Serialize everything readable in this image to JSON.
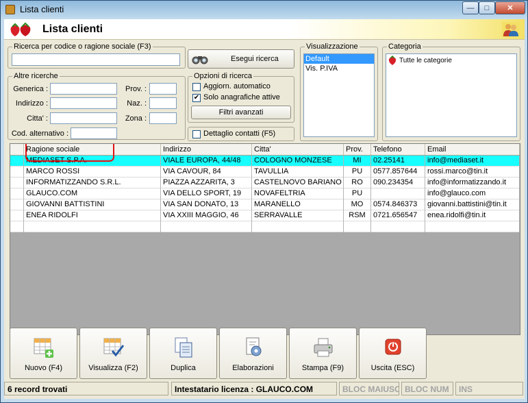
{
  "window": {
    "title": "Lista clienti",
    "minimize": "—",
    "maximize": "□",
    "close": "✕"
  },
  "header": {
    "title": "Lista clienti",
    "logo_icon": "strawberry-icon",
    "users_icon": "users-icon"
  },
  "search": {
    "group_label": "Ricerca per codice o ragione sociale (F3)",
    "value": "",
    "button_label": "Esegui ricerca",
    "button_icon": "binoculars-icon"
  },
  "other_searches": {
    "group_label": "Altre ricerche",
    "generica_label": "Generica :",
    "indirizzo_label": "Indirizzo :",
    "citta_label": "Citta' :",
    "cod_alt_label": "Cod. alternativo :",
    "prov_label": "Prov. :",
    "naz_label": "Naz. :",
    "zona_label": "Zona :"
  },
  "options": {
    "group_label": "Opzioni di ricerca",
    "aggiorn_label": "Aggiorn. automatico",
    "aggiorn_checked": false,
    "solo_label": "Solo anagrafiche attive",
    "solo_checked": true,
    "filter_button": "Filtri avanzati",
    "detail_label": "Dettaglio contatti (F5)",
    "detail_checked": false
  },
  "view": {
    "group_label": "Visualizzazione",
    "items": [
      "Default",
      "Vis. P.IVA"
    ],
    "selected": "Default"
  },
  "category": {
    "group_label": "Categoria",
    "items": [
      "Tutte le categorie"
    ]
  },
  "grid": {
    "columns": [
      "Ragione sociale",
      "Indirizzo",
      "Citta'",
      "Prov.",
      "Telefono",
      "Email"
    ],
    "rows": [
      [
        "MEDIASET S.P.A.",
        "VIALE EUROPA, 44/48",
        "COLOGNO MONZESE",
        "MI",
        "02.25141",
        "info@mediaset.it"
      ],
      [
        "MARCO ROSSI",
        "VIA CAVOUR, 84",
        "TAVULLIA",
        "PU",
        "0577.857644",
        "rossi.marco@tin.it"
      ],
      [
        "INFORMATIZZANDO S.R.L.",
        "PIAZZA AZZARITA, 3",
        "CASTELNOVO BARIANO",
        "RO",
        "090.234354",
        "info@informatizzando.it"
      ],
      [
        "GLAUCO.COM",
        "VIA DELLO SPORT, 19",
        "NOVAFELTRIA",
        "PU",
        "",
        "info@glauco.com"
      ],
      [
        "GIOVANNI BATTISTINI",
        "VIA SAN DONATO, 13",
        "MARANELLO",
        "MO",
        "0574.846373",
        "giovanni.battistini@tin.it"
      ],
      [
        "ENEA RIDOLFI",
        "VIA XXIII MAGGIO, 46",
        "SERRAVALLE",
        "RSM",
        "0721.656547",
        "enea.ridolfi@tin.it"
      ]
    ],
    "selected_row": 0
  },
  "toolbar": {
    "buttons": [
      {
        "label": "Nuovo (F4)",
        "icon": "new-table-icon"
      },
      {
        "label": "Visualizza (F2)",
        "icon": "view-table-icon"
      },
      {
        "label": "Duplica",
        "icon": "duplicate-icon"
      },
      {
        "label": "Elaborazioni",
        "icon": "gear-document-icon"
      },
      {
        "label": "Stampa (F9)",
        "icon": "printer-icon"
      },
      {
        "label": "Uscita (ESC)",
        "icon": "exit-icon"
      }
    ]
  },
  "status": {
    "records": "6 record trovati",
    "license": "Intestatario licenza : GLAUCO.COM",
    "caps": "BLOC MAIUSC",
    "num": "BLOC NUM",
    "ins": "INS"
  },
  "colors": {
    "selected_row": "#18ffff",
    "highlight": "#e01515",
    "window_frame": "#8fb9dc"
  }
}
